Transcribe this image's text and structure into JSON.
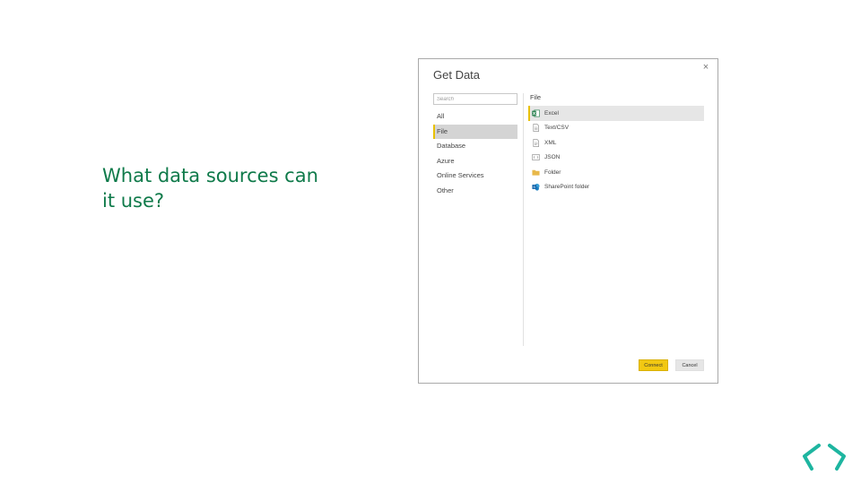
{
  "slide": {
    "question": "What data sources can it use?"
  },
  "dialog": {
    "title": "Get Data",
    "close_label": "×",
    "search": {
      "placeholder": "Search"
    },
    "categories": [
      {
        "label": "All",
        "selected": false
      },
      {
        "label": "File",
        "selected": true
      },
      {
        "label": "Database",
        "selected": false
      },
      {
        "label": "Azure",
        "selected": false
      },
      {
        "label": "Online Services",
        "selected": false
      },
      {
        "label": "Other",
        "selected": false
      }
    ],
    "section_header": "File",
    "sources": [
      {
        "label": "Excel",
        "icon": "excel-icon",
        "selected": true
      },
      {
        "label": "Text/CSV",
        "icon": "text-file-icon",
        "selected": false
      },
      {
        "label": "XML",
        "icon": "xml-file-icon",
        "selected": false
      },
      {
        "label": "JSON",
        "icon": "json-file-icon",
        "selected": false
      },
      {
        "label": "Folder",
        "icon": "folder-icon",
        "selected": false
      },
      {
        "label": "SharePoint folder",
        "icon": "sharepoint-icon",
        "selected": false
      }
    ],
    "buttons": {
      "connect": "Connect",
      "cancel": "Cancel"
    }
  },
  "colors": {
    "question_text": "#0f7a4a",
    "accent_yellow": "#f2c811",
    "nav_chevron": "#1eb5a0"
  },
  "nav": {
    "icon": "prev-next-chevrons-icon"
  }
}
